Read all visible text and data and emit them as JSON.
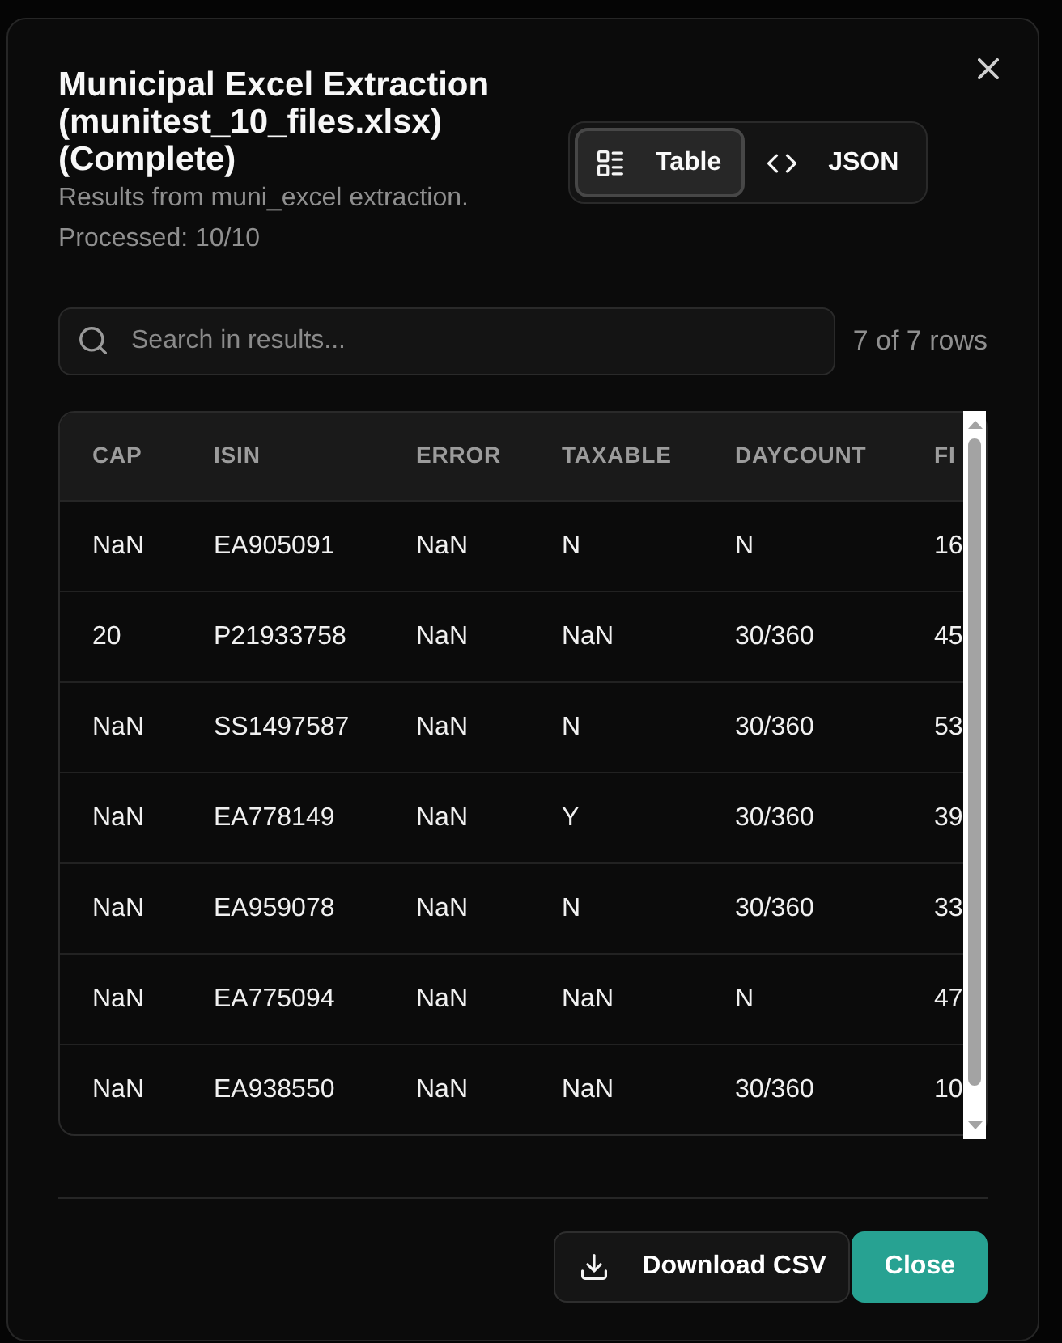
{
  "dialog": {
    "title": "Municipal Excel Extraction (munitest_10_files.xlsx) (Complete)",
    "description": "Results from muni_excel extraction.",
    "progress": "Processed: 10/10"
  },
  "view_toggle": [
    {
      "label": "Table",
      "selected": true
    },
    {
      "label": "JSON",
      "selected": false
    }
  ],
  "search": {
    "placeholder": "Search in results...",
    "result_count": "7 of 7 rows"
  },
  "table": {
    "columns": [
      "CAP",
      "ISIN",
      "ERROR",
      "TAXABLE",
      "DAYCOUNT",
      "FI"
    ],
    "rows": [
      [
        "NaN",
        "EA905091",
        "NaN",
        "N",
        "N",
        "16"
      ],
      [
        "20",
        "P21933758",
        "NaN",
        "NaN",
        "30/360",
        "45"
      ],
      [
        "NaN",
        "SS1497587",
        "NaN",
        "N",
        "30/360",
        "53"
      ],
      [
        "NaN",
        "EA778149",
        "NaN",
        "Y",
        "30/360",
        "39"
      ],
      [
        "NaN",
        "EA959078",
        "NaN",
        "N",
        "30/360",
        "33"
      ],
      [
        "NaN",
        "EA775094",
        "NaN",
        "NaN",
        "N",
        "47"
      ],
      [
        "NaN",
        "EA938550",
        "NaN",
        "NaN",
        "30/360",
        "10"
      ]
    ]
  },
  "buttons": [
    {
      "label": "Download CSV",
      "kind": "download"
    },
    {
      "label": "Close",
      "kind": "primary"
    }
  ]
}
